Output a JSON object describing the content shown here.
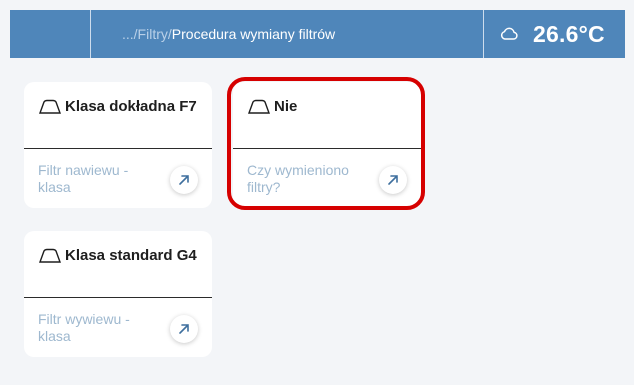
{
  "topbar": {
    "breadcrumb_prefix": ".../Filtry/",
    "breadcrumb_current": "Procedura wymiany filtrów",
    "weather_icon": "cloud-icon",
    "temperature": "26.6°C"
  },
  "cards": [
    {
      "title": "Klasa dokładna F7",
      "description": "Filtr nawiewu - klasa"
    },
    {
      "title": "Nie",
      "description": "Czy wymieniono filtry?"
    },
    {
      "title": "Klasa standard G4",
      "description": "Filtr wywiewu - klasa"
    }
  ],
  "colors": {
    "header": "#4f86ba",
    "background": "#f3f5f8",
    "highlight": "#d60000",
    "muted_text": "#9eb8cf"
  }
}
